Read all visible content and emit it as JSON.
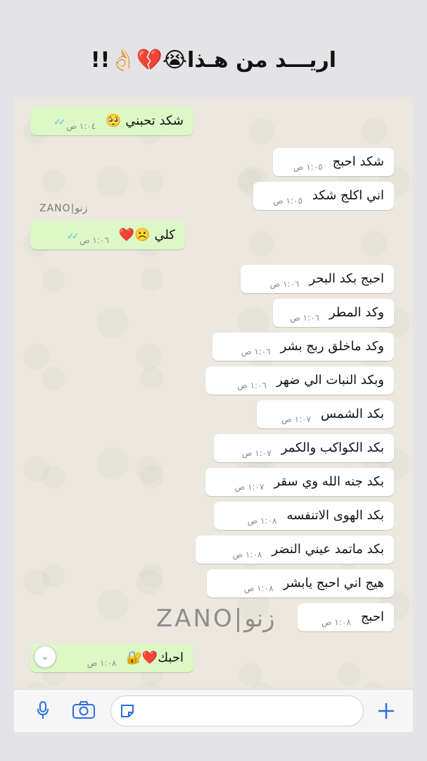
{
  "header": {
    "title": "اريـــد من هـذا😭💔👌🏻!!"
  },
  "watermark": {
    "small": "ZANO|زنو",
    "large": "ZANO|زنو"
  },
  "messages": [
    {
      "dir": "out",
      "text": "شكد تحبني 🥺",
      "time": "١:٠٤ ص",
      "ticks": true
    },
    {
      "dir": "in",
      "text": "شكد احبج",
      "time": "١:٠٥ ص"
    },
    {
      "dir": "in",
      "text": "اني اكلج شكد",
      "time": "١:٠٥ ص"
    },
    {
      "dir": "out",
      "text": "كلي ☹️❤️",
      "time": "١:٠٦ ص",
      "ticks": true
    },
    {
      "dir": "in",
      "text": "احبج بكد البحر",
      "time": "١:٠٦ ص"
    },
    {
      "dir": "in",
      "text": "وكد المطر",
      "time": "١:٠٦ ص"
    },
    {
      "dir": "in",
      "text": "وكد ماخلق ربج بشر",
      "time": "١:٠٦ ص"
    },
    {
      "dir": "in",
      "text": "وبكد النبات الي ضهر",
      "time": "١:٠٦ ص"
    },
    {
      "dir": "in",
      "text": "بكد الشمس",
      "time": "١:٠٧ ص"
    },
    {
      "dir": "in",
      "text": "بكد الكواكب والكمر",
      "time": "١:٠٧ ص"
    },
    {
      "dir": "in",
      "text": "بكد جنه الله وي سقر",
      "time": "١:٠٧ ص"
    },
    {
      "dir": "in",
      "text": "بكد الهوى الاتنفسه",
      "time": "١:٠٨ ص"
    },
    {
      "dir": "in",
      "text": "بكد ماتمد عيني النضر",
      "time": "١:٠٨ ص"
    },
    {
      "dir": "in",
      "text": "هيج اني احبج يابشر",
      "time": "١:٠٨ ص"
    },
    {
      "dir": "in",
      "text": "احبج",
      "time": "١:٠٨ ص"
    },
    {
      "dir": "out",
      "text": "احبك❤️🔐",
      "time": "١:٠٨ ص"
    }
  ],
  "input_bar": {
    "plus_icon": "plus-icon",
    "sticker_icon": "sticker-icon",
    "camera_icon": "camera-icon",
    "mic_icon": "microphone-icon"
  }
}
